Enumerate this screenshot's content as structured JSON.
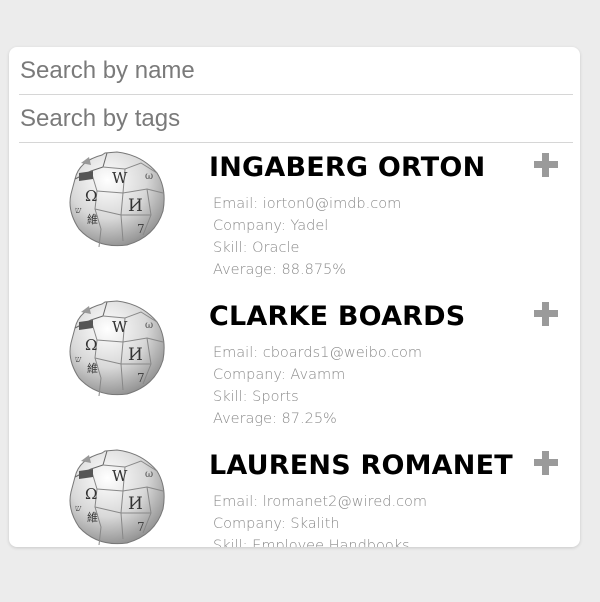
{
  "search": {
    "name_placeholder": "Search by name",
    "tags_placeholder": "Search by tags"
  },
  "students": [
    {
      "name": "INGABERG ORTON",
      "email": "Email: iorton0@imdb.com",
      "company": "Company: Yadel",
      "skill": "Skill: Oracle",
      "average": "Average: 88.875%"
    },
    {
      "name": "CLARKE BOARDS",
      "email": "Email: cboards1@weibo.com",
      "company": "Company: Avamm",
      "skill": "Skill: Sports",
      "average": "Average: 87.25%"
    },
    {
      "name": "LAURENS ROMANET",
      "email": "Email: lromanet2@wired.com",
      "company": "Company: Skalith",
      "skill": "Skill: Employee Handbooks",
      "average": ""
    }
  ]
}
